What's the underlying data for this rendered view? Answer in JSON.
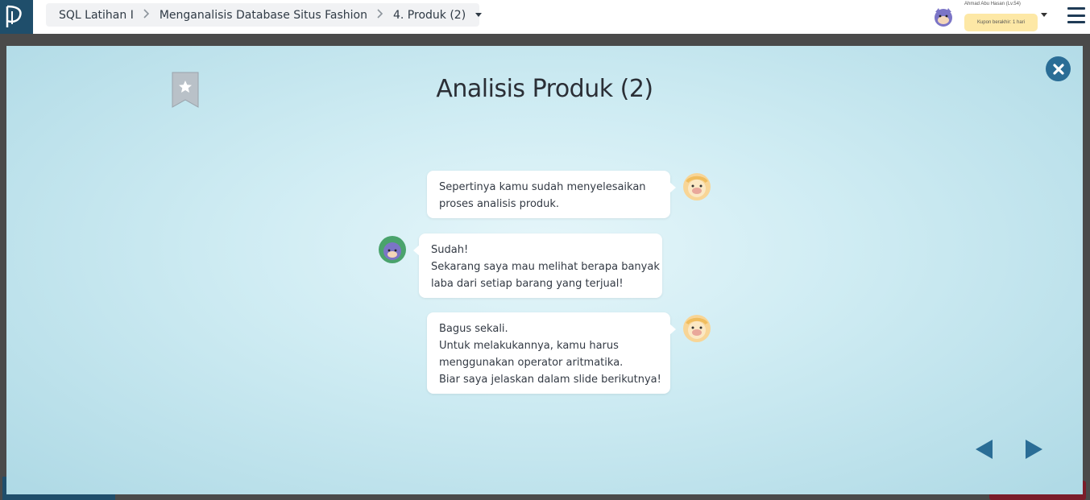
{
  "header": {
    "breadcrumb": [
      {
        "label": "SQL Latihan I"
      },
      {
        "label": "Menganalisis Database Situs Fashion"
      },
      {
        "label": "4. Produk (2)"
      }
    ],
    "user": {
      "name": "Ahmad Abu Hasan (Lv.54)",
      "coupon": "Kupon berakhir: 1 hari"
    }
  },
  "modal": {
    "title": "Analisis Produk (2)",
    "messages": [
      {
        "speaker": "mentor",
        "side": "right",
        "lines": [
          "Sepertinya kamu sudah menyelesaikan",
          "proses analisis produk."
        ]
      },
      {
        "speaker": "student",
        "side": "left",
        "lines": [
          "Sudah!",
          "Sekarang saya mau melihat berapa banyak",
          "laba dari setiap barang yang terjual!"
        ]
      },
      {
        "speaker": "mentor",
        "side": "right",
        "lines": [
          "Bagus sekali.",
          "Untuk melakukannya, kamu harus",
          "menggunakan operator aritmatika.",
          "Biar saya jelaskan dalam slide berikutnya!"
        ]
      }
    ]
  },
  "colors": {
    "accent": "#2a6d96",
    "logo_bg": "#1f4e6b",
    "coupon_bg": "#fde8a6"
  },
  "icons": [
    "logo-icon",
    "chevron-right-icon",
    "caret-down-icon",
    "user-avatar-icon",
    "hamburger-menu-icon",
    "bookmark-star-icon",
    "close-icon",
    "mentor-avatar-icon",
    "student-avatar-icon",
    "prev-arrow-icon",
    "next-arrow-icon"
  ]
}
